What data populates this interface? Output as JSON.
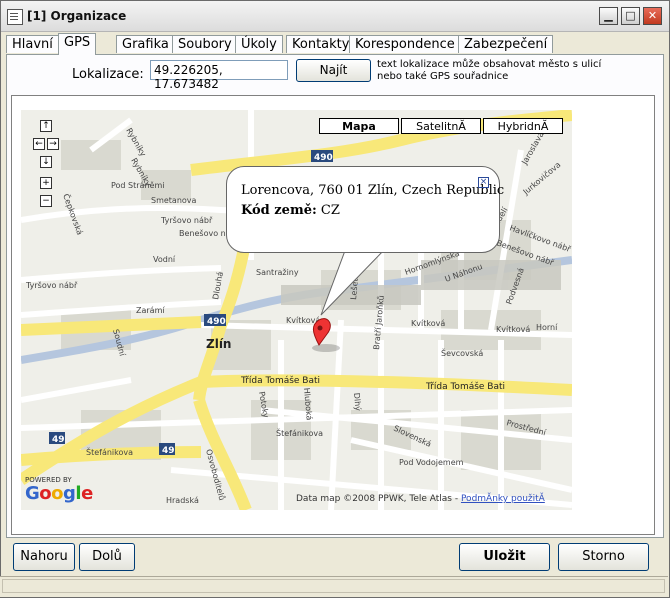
{
  "window": {
    "title": "[1] Organizace"
  },
  "tabs": [
    {
      "label": "Hlavní",
      "active": false
    },
    {
      "label": "GPS",
      "active": true
    },
    {
      "label": "Grafika",
      "active": false
    },
    {
      "label": "Soubory",
      "active": false
    },
    {
      "label": "Úkoly",
      "active": false
    },
    {
      "label": "Kontakty",
      "active": false
    },
    {
      "label": "Korespondence",
      "active": false
    },
    {
      "label": "Zabezpečení",
      "active": false
    }
  ],
  "location": {
    "label": "Lokalizace:",
    "value": "49.226205, 17.673482",
    "find_label": "Najít",
    "hint_line1": "text lokalizace může obsahovat město s ulicí",
    "hint_line2": "nebo také GPS souřadnice"
  },
  "map": {
    "type_buttons": [
      "Mapa",
      "SatelitnĂ",
      "HybridnĂ"
    ],
    "active_type": "Mapa",
    "info_address": "Lorencova, 760 01 Zlín, Czech Republic",
    "info_country_label": "Kód země:",
    "info_country_value": "CZ",
    "copyright": "Data map ©2008 PPWK, Tele Atlas - ",
    "terms_link": "PodmĂnky použitĂ",
    "powered_by": "POWERED BY",
    "logo": "Google",
    "street_labels": [
      "Rybníky",
      "Rybníky",
      "Pod Stráněmi",
      "Smetanova",
      "Tyršovo nábř",
      "Benešovo nábř",
      "Čepkovská",
      "Tyršovo nábř",
      "Vodní",
      "Santražiny",
      "Dlouhá",
      "Zarámí",
      "Zlín",
      "Kvítková",
      "Kvítková",
      "Kvítková",
      "Třída Tomáše Bati",
      "Třída Tomáše Bati",
      "Štefánikova",
      "Štefánikova",
      "Hradská",
      "Osvoboditelů",
      "Hluboká",
      "Dlhý",
      "Slovenská",
      "Pod Vodojemem",
      "Prostřední",
      "U Náhonu",
      "Padělí",
      "Jaroslava",
      "Lešetín",
      "Bratří Jaroňků",
      "Hornomlýnská",
      "Ševcovská",
      "Benešovo nábř",
      "Havlíčkovo nábř",
      "Jurkovičova",
      "Podvesná",
      "Horní",
      "Potoky",
      "Soudní"
    ],
    "route_badges": [
      "490",
      "490",
      "49",
      "49"
    ]
  },
  "buttons": {
    "up": "Nahoru",
    "down": "Dolů",
    "save": "Uložit",
    "cancel": "Storno"
  }
}
